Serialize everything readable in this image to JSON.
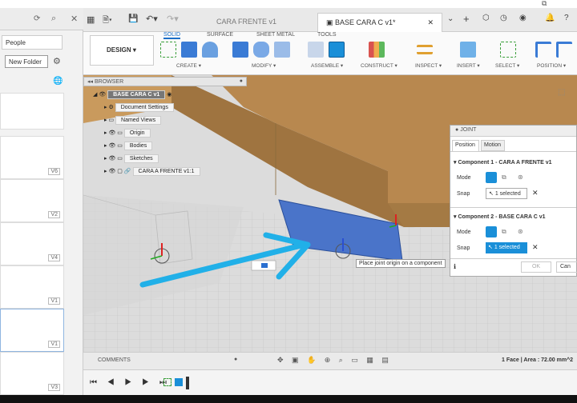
{
  "app": {
    "left_panel": {
      "people_label": "People",
      "new_folder_label": "New Folder",
      "versions": [
        "V6",
        "V2",
        "V4",
        "V1",
        "V1",
        "V3"
      ]
    },
    "tabs": [
      {
        "label": "CARA FRENTE v1"
      },
      {
        "label": "BASE CARA C v1*"
      }
    ]
  },
  "ribbon": {
    "workspace": "DESIGN",
    "tabs": [
      "SOLID",
      "SURFACE",
      "SHEET METAL",
      "TOOLS"
    ],
    "groups": [
      "CREATE ▾",
      "MODIFY ▾",
      "ASSEMBLE ▾",
      "CONSTRUCT ▾",
      "INSPECT ▾",
      "INSERT ▾",
      "SELECT ▾",
      "POSITION ▾"
    ]
  },
  "browser": {
    "title": "BROWSER",
    "root": "BASE CARA C v1",
    "items": [
      "Document Settings",
      "Named Views",
      "Origin",
      "Bodies",
      "Sketches",
      "CARA A FRENTE v1:1"
    ]
  },
  "joint": {
    "title": "JOINT",
    "tabs": [
      "Position",
      "Motion"
    ],
    "component1": {
      "title": "Component 1 - CARA A FRENTE v1",
      "mode_label": "Mode",
      "snap_label": "Snap",
      "snap_value": "1 selected"
    },
    "component2": {
      "title": "Component 2 - BASE CARA C v1",
      "mode_label": "Mode",
      "snap_label": "Snap",
      "snap_value": "1 selected"
    },
    "ok": "OK",
    "cancel": "Can"
  },
  "viewport": {
    "tooltip": "Place joint origin on a component"
  },
  "bottom": {
    "comments": "COMMENTS",
    "status": "1 Face | Area : 72.00 mm^2"
  },
  "colors": {
    "accent": "#1a8fd8",
    "wood": "#b8884f",
    "face_blue": "#4a74c9",
    "arrow": "#21b0e8"
  }
}
